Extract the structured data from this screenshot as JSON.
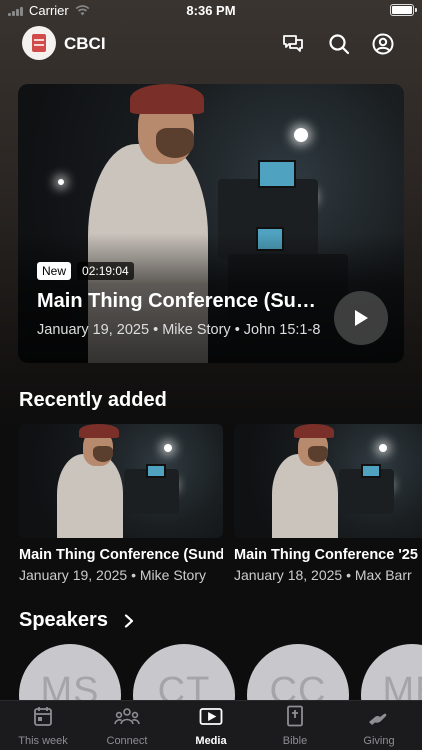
{
  "status_bar": {
    "carrier": "Carrier",
    "time": "8:36 PM"
  },
  "header": {
    "app_name": "CBCI",
    "icons": [
      "chat-icon",
      "search-icon",
      "account-icon"
    ]
  },
  "hero": {
    "badge": "New",
    "duration": "02:19:04",
    "title": "Main Thing Conference (Sunday)",
    "meta": "January 19, 2025 • Mike Story • John 15:1-8"
  },
  "recently_added": {
    "title": "Recently added",
    "items": [
      {
        "title": "Main Thing Conference (Sunday)",
        "meta": "January 19, 2025 • Mike Story"
      },
      {
        "title": "Main Thing Conference '25",
        "meta": "January 18, 2025 • Max Barr"
      }
    ]
  },
  "speakers": {
    "title": "Speakers",
    "items": [
      {
        "initials": "MS"
      },
      {
        "initials": "CT"
      },
      {
        "initials": "CC"
      },
      {
        "initials": "MB"
      }
    ]
  },
  "tabs": [
    {
      "label": "This week",
      "icon": "calendar-icon",
      "active": false
    },
    {
      "label": "Connect",
      "icon": "people-icon",
      "active": false
    },
    {
      "label": "Media",
      "icon": "play-screen-icon",
      "active": true
    },
    {
      "label": "Bible",
      "icon": "bible-icon",
      "active": false
    },
    {
      "label": "Giving",
      "icon": "hand-icon",
      "active": false
    }
  ]
}
